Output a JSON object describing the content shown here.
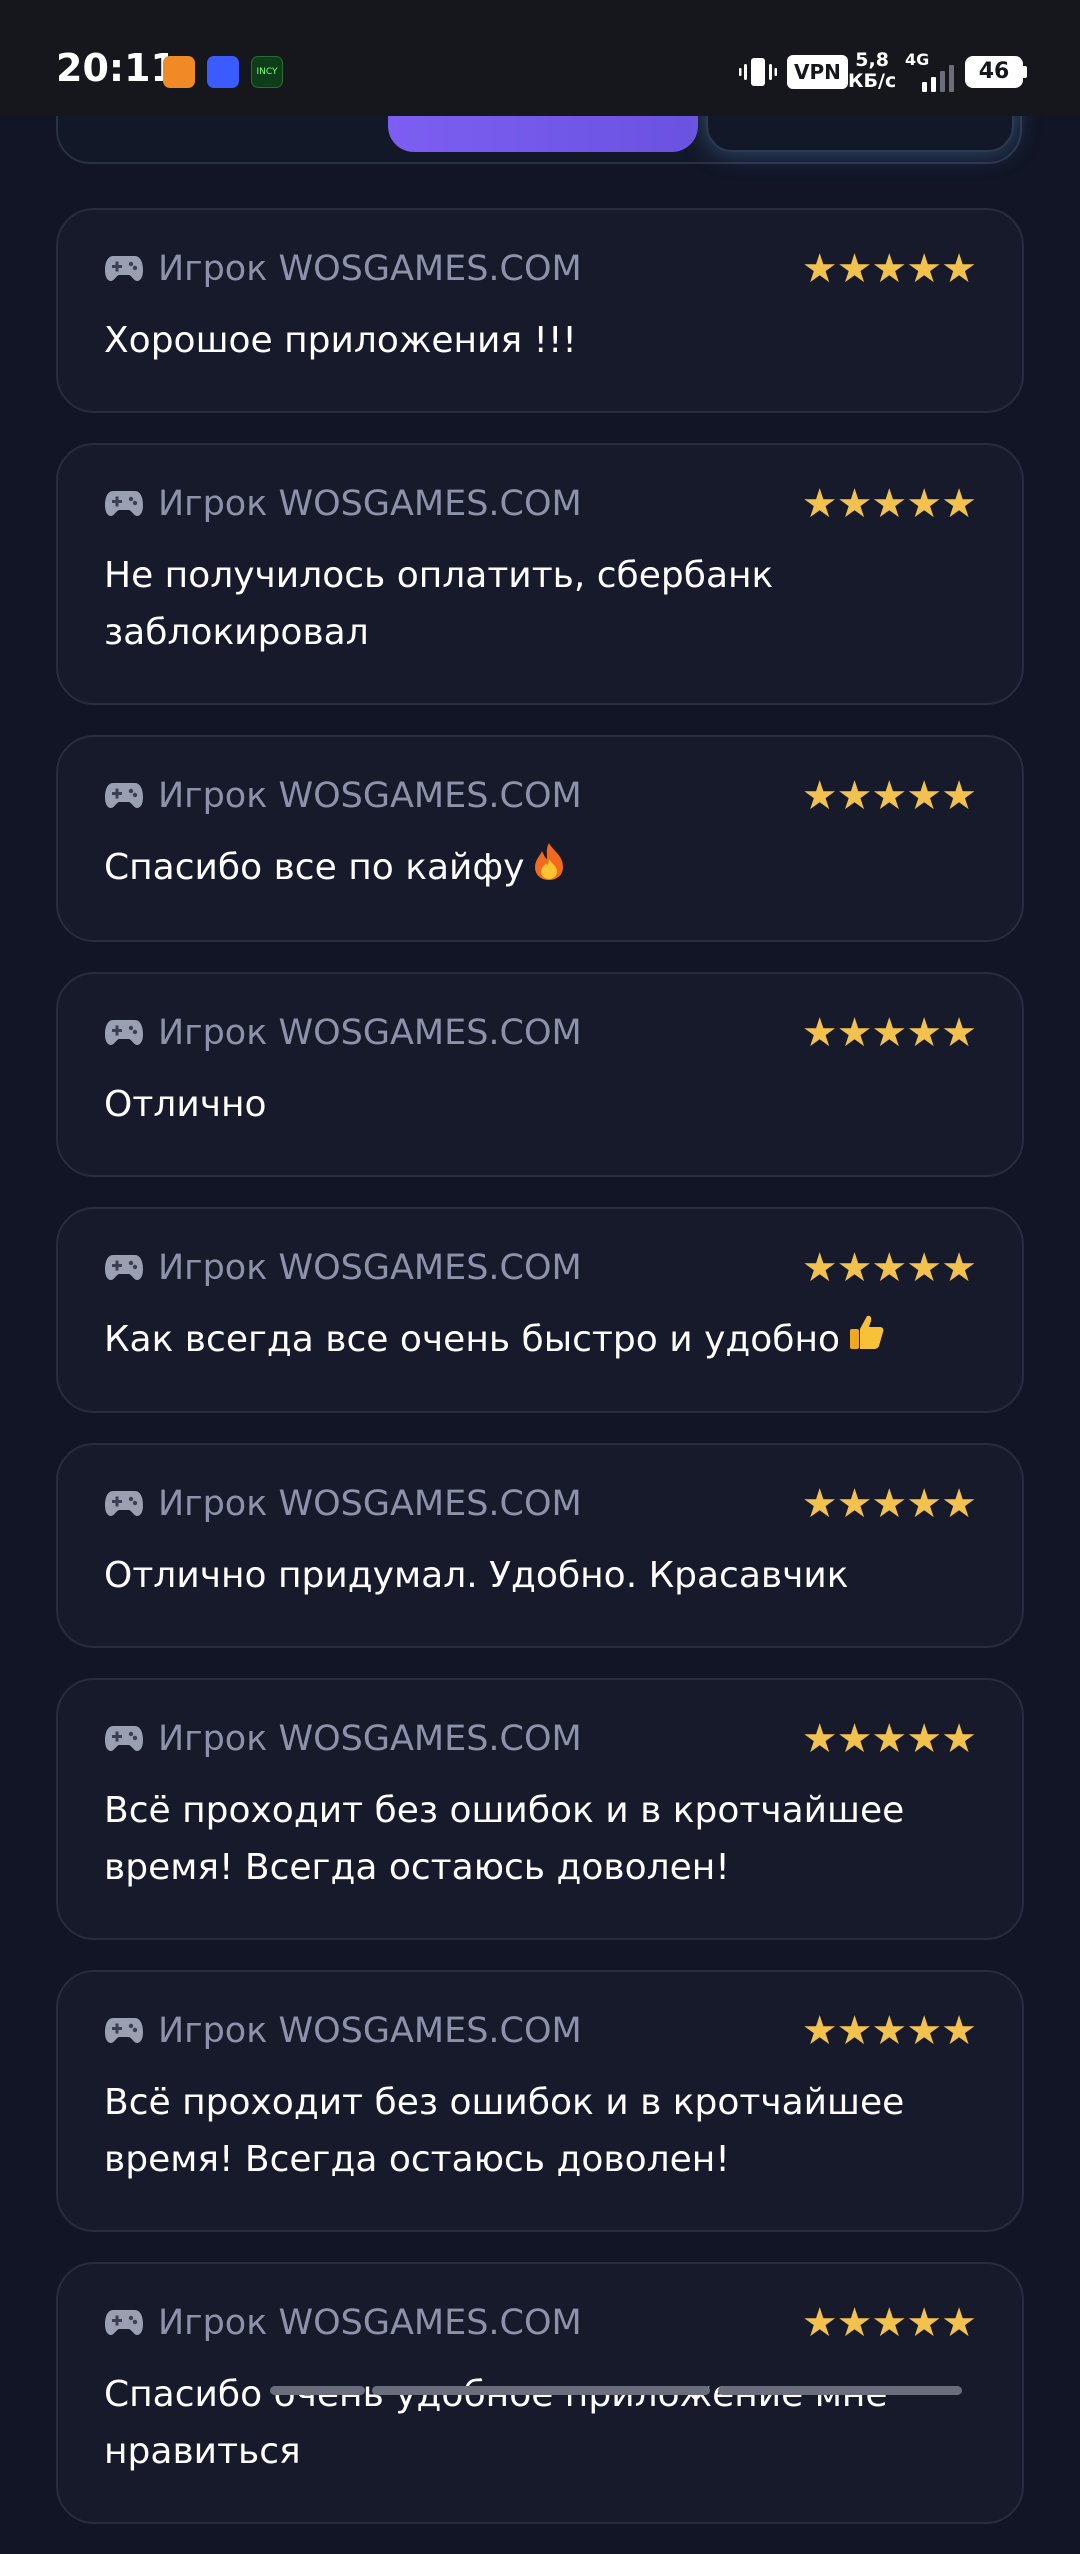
{
  "status_bar": {
    "time": "20:11",
    "vpn": "VPN",
    "speed_value": "5,8",
    "speed_unit": "КБ/с",
    "network": "4G",
    "battery": "46"
  },
  "icons": {
    "vibrate": "vibrate-icon",
    "signal": "signal-icon",
    "gamepad": "gamepad-icon",
    "star": "star-icon",
    "fire": "fire-icon",
    "thumbs_up": "thumbs-up-icon"
  },
  "colors": {
    "background": "#111526",
    "card": "#161a2b",
    "accent": "#7c5ff2",
    "star": "#f2c14e",
    "name": "#8d92aa"
  },
  "reviews": [
    {
      "name": "Игрок WOSGAMES.COM",
      "stars": "★★★★★",
      "rating": 5,
      "text": "Хорошое приложения !!!"
    },
    {
      "name": "Игрок WOSGAMES.COM",
      "stars": "★★★★★",
      "rating": 5,
      "text": "Не получилось оплатить, сбербанк заблокировал"
    },
    {
      "name": "Игрок WOSGAMES.COM",
      "stars": "★★★★★",
      "rating": 5,
      "text": "Спасибо все по кайфу"
    },
    {
      "name": "Игрок WOSGAMES.COM",
      "stars": "★★★★★",
      "rating": 5,
      "text": "Отлично"
    },
    {
      "name": "Игрок WOSGAMES.COM",
      "stars": "★★★★★",
      "rating": 5,
      "text": "Как всегда все очень быстро и удобно"
    },
    {
      "name": "Игрок WOSGAMES.COM",
      "stars": "★★★★★",
      "rating": 5,
      "text": "Отлично придумал. Удобно. Красавчик"
    },
    {
      "name": "Игрок WOSGAMES.COM",
      "stars": "★★★★★",
      "rating": 5,
      "text": "Всё проходит без ошибок и в кротчайшее время! Всегда остаюсь доволен!"
    },
    {
      "name": "Игрок WOSGAMES.COM",
      "stars": "★★★★★",
      "rating": 5,
      "text": "Всё проходит без ошибок и в кротчайшее время! Всегда остаюсь доволен!"
    },
    {
      "name": "Игрок WOSGAMES.COM",
      "stars": "★★★★★",
      "rating": 5,
      "text": "Спасибо очень удобное приложение мне нравиться"
    }
  ]
}
